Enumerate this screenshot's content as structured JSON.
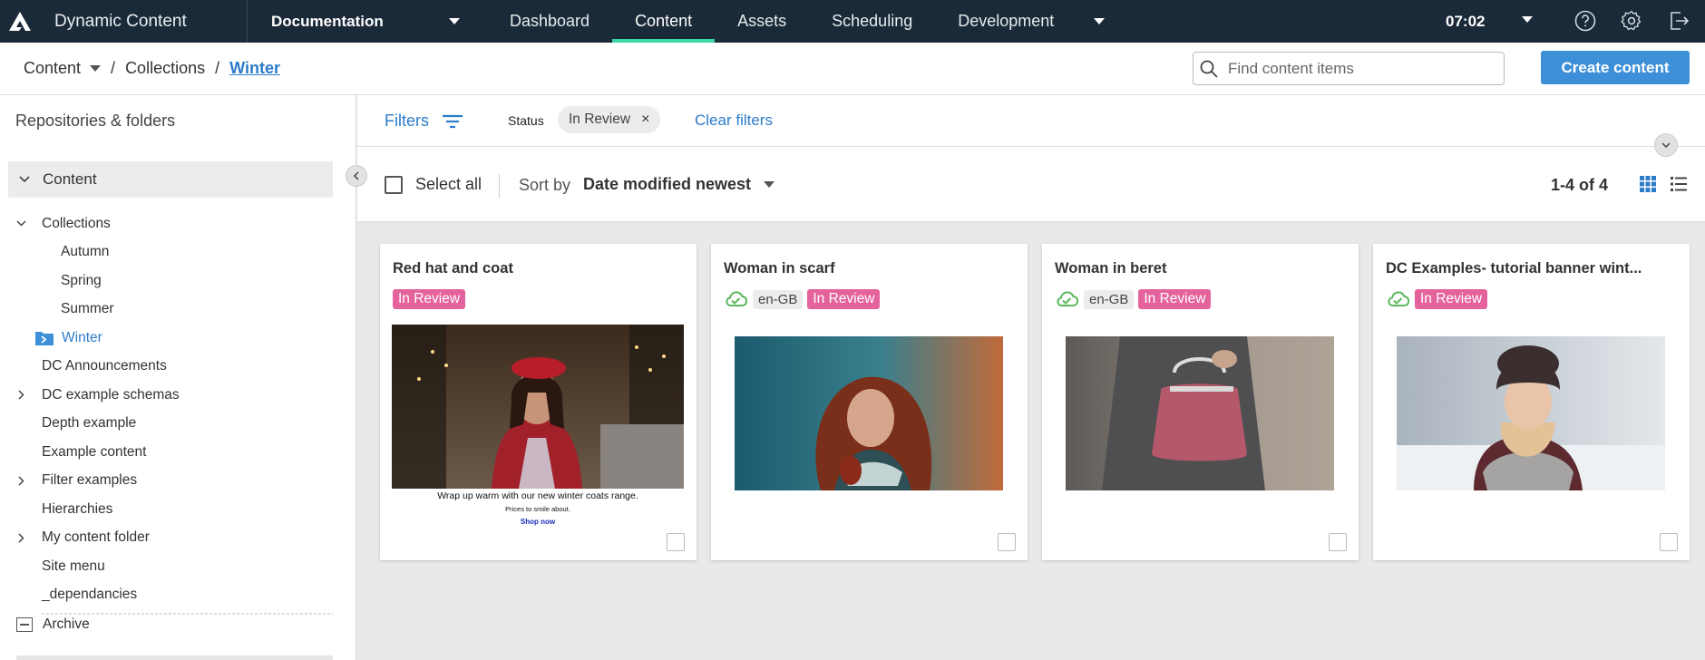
{
  "app": {
    "brand_name": "Dynamic Content",
    "hub": "Documentation",
    "nav_tabs": [
      {
        "label": "Dashboard",
        "active": false
      },
      {
        "label": "Content",
        "active": true
      },
      {
        "label": "Assets",
        "active": false
      },
      {
        "label": "Scheduling",
        "active": false
      },
      {
        "label": "Development",
        "active": false
      }
    ],
    "clock": "07:02",
    "icons": [
      "help-icon",
      "settings-icon",
      "sign-out-icon"
    ],
    "accent_color": "#3ed6a8",
    "nav_bg": "#1b2a38"
  },
  "breadcrumb": {
    "root": "Content",
    "middle": "Collections",
    "current": "Winter"
  },
  "search": {
    "placeholder": "Find content items",
    "value": ""
  },
  "create_button": "Create content",
  "sidebar": {
    "heading": "Repositories & folders",
    "root": "Content",
    "tree": [
      {
        "label": "Collections",
        "level": 0,
        "expander": "down"
      },
      {
        "label": "Autumn",
        "level": 1
      },
      {
        "label": "Spring",
        "level": 1
      },
      {
        "label": "Summer",
        "level": 1
      },
      {
        "label": "Winter",
        "level": 1,
        "selected": true
      },
      {
        "label": "DC Announcements",
        "level": 0
      },
      {
        "label": "DC example schemas",
        "level": 0,
        "expander": "right"
      },
      {
        "label": "Depth example",
        "level": 0
      },
      {
        "label": "Example content",
        "level": 0
      },
      {
        "label": "Filter examples",
        "level": 0,
        "expander": "right"
      },
      {
        "label": "Hierarchies",
        "level": 0
      },
      {
        "label": "My content folder",
        "level": 0,
        "expander": "right"
      },
      {
        "label": "Site menu",
        "level": 0
      },
      {
        "label": "_dependancies",
        "level": 0
      }
    ],
    "archive": "Archive"
  },
  "filters": {
    "label": "Filters",
    "status_label": "Status",
    "chip": "In Review",
    "clear": "Clear filters"
  },
  "toolbar": {
    "select_all": "Select all",
    "sort_label": "Sort by",
    "sort_value": "Date modified newest",
    "count": "1-4 of 4"
  },
  "cards": [
    {
      "title": "Red hat and coat",
      "locale": "",
      "status": "In Review",
      "banner_text": "Wrap up warm with our new winter coats range.",
      "banner_sub": "Prices to smile about.",
      "banner_link": "Shop now"
    },
    {
      "title": "Woman in scarf",
      "locale": "en-GB",
      "status": "In Review"
    },
    {
      "title": "Woman in beret",
      "locale": "en-GB",
      "status": "In Review"
    },
    {
      "title": "DC Examples- tutorial banner wint...",
      "locale": "",
      "status": "In Review"
    }
  ],
  "status_color": "#e5639c",
  "link_color": "#2b7cc9"
}
